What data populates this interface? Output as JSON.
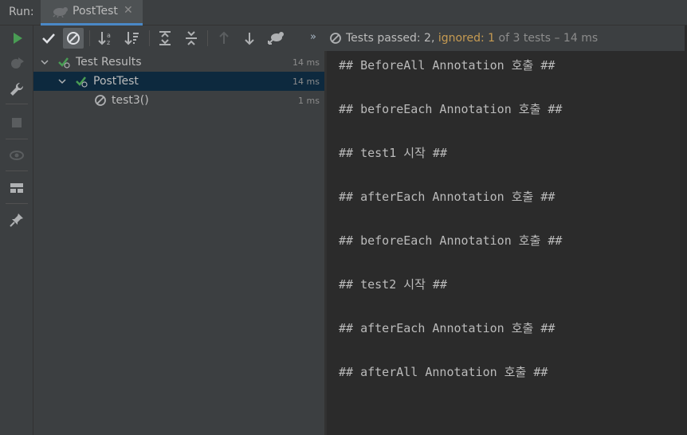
{
  "tabbar": {
    "run_label": "Run:",
    "tab_label": "PostTest",
    "tab_icon": "junit-run-icon",
    "close_glyph": "✕"
  },
  "left_strip": {
    "buttons": [
      "rerun-icon",
      "debug-rerun-icon",
      "settings-wrench-icon",
      "stop-icon",
      "view-icon",
      "layout-icon",
      "pin-icon"
    ]
  },
  "toolbar": {
    "buttons": [
      "show-passed-icon",
      "show-ignored-icon",
      "sort-alpha-icon",
      "sort-duration-icon",
      "expand-all-icon",
      "collapse-all-icon",
      "previous-failed-icon",
      "next-failed-icon",
      "import-tests-icon"
    ],
    "overflow": "»"
  },
  "status": {
    "passed_label": "Tests passed: 2, ",
    "ignored_label": "ignored: 1",
    "total_label": " of 3 tests",
    "duration_label": " – 14 ms"
  },
  "tree": {
    "root": {
      "label": "Test Results",
      "duration": "14 ms",
      "status": "passed"
    },
    "class": {
      "label": "PostTest",
      "duration": "14 ms",
      "status": "passed"
    },
    "methods": [
      {
        "label": "test3()",
        "duration": "1 ms",
        "status": "ignored"
      }
    ]
  },
  "output": {
    "lines": [
      "## BeforeAll Annotation 호출 ##",
      "## beforeEach Annotation 호출 ##",
      "## test1 시작 ##",
      "## afterEach Annotation 호출 ##",
      "## beforeEach Annotation 호출 ##",
      "## test2 시작 ##",
      "## afterEach Annotation 호출 ##",
      "## afterAll Annotation 호출 ##"
    ]
  },
  "colors": {
    "background": "#2b2b2b",
    "panel": "#3c3f41",
    "selection": "#0d293e",
    "accent_green": "#499c54",
    "ignored_orange": "#c69b52",
    "tab_underline": "#4a88c7"
  }
}
